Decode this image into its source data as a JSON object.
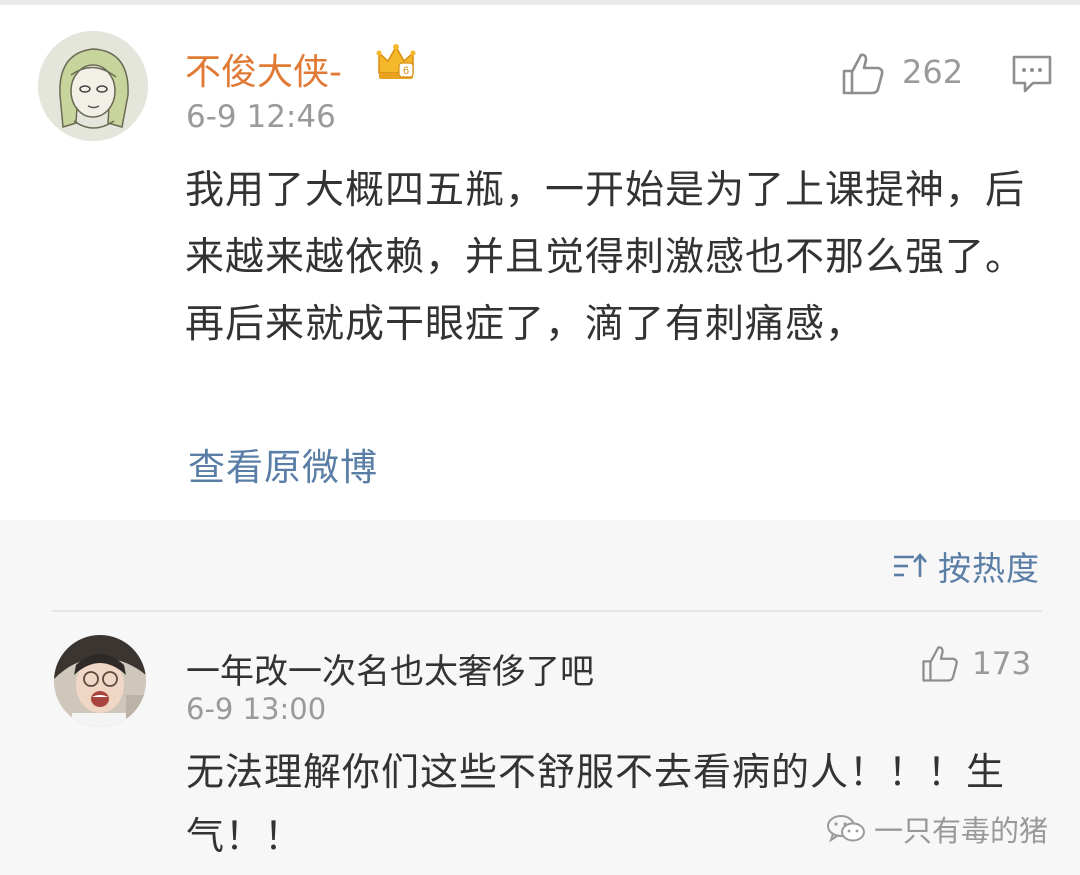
{
  "post": {
    "username": "不俊大侠-",
    "time": "6-9 12:46",
    "like_count": "262",
    "text": "我用了大概四五瓶，一开始是为了上课提神，后来越来越依赖，并且觉得刺激感也不那么强了。再后来就成干眼症了，滴了有刺痛感，",
    "view_original": "查看原微博",
    "crown_digit": "6",
    "icons": [
      "crown-badge-icon",
      "thumbs-up-icon",
      "comment-icon"
    ]
  },
  "sort": {
    "label": "按热度",
    "icon": "sort-icon"
  },
  "comment": {
    "name": "一年改一次名也太奢侈了吧",
    "time": "6-9 13:00",
    "like_count": "173",
    "text": "无法理解你们这些不舒服不去看病的人！！！生气！！",
    "icon": "thumbs-up-icon"
  },
  "watermark": {
    "text": "一只有毒的猪",
    "icon": "wechat-icon"
  },
  "colors": {
    "username": "#e07a34",
    "link": "#5a7ea6",
    "meta": "#9a9a9a",
    "text": "#333333",
    "comments_bg": "#f7f7f7"
  }
}
